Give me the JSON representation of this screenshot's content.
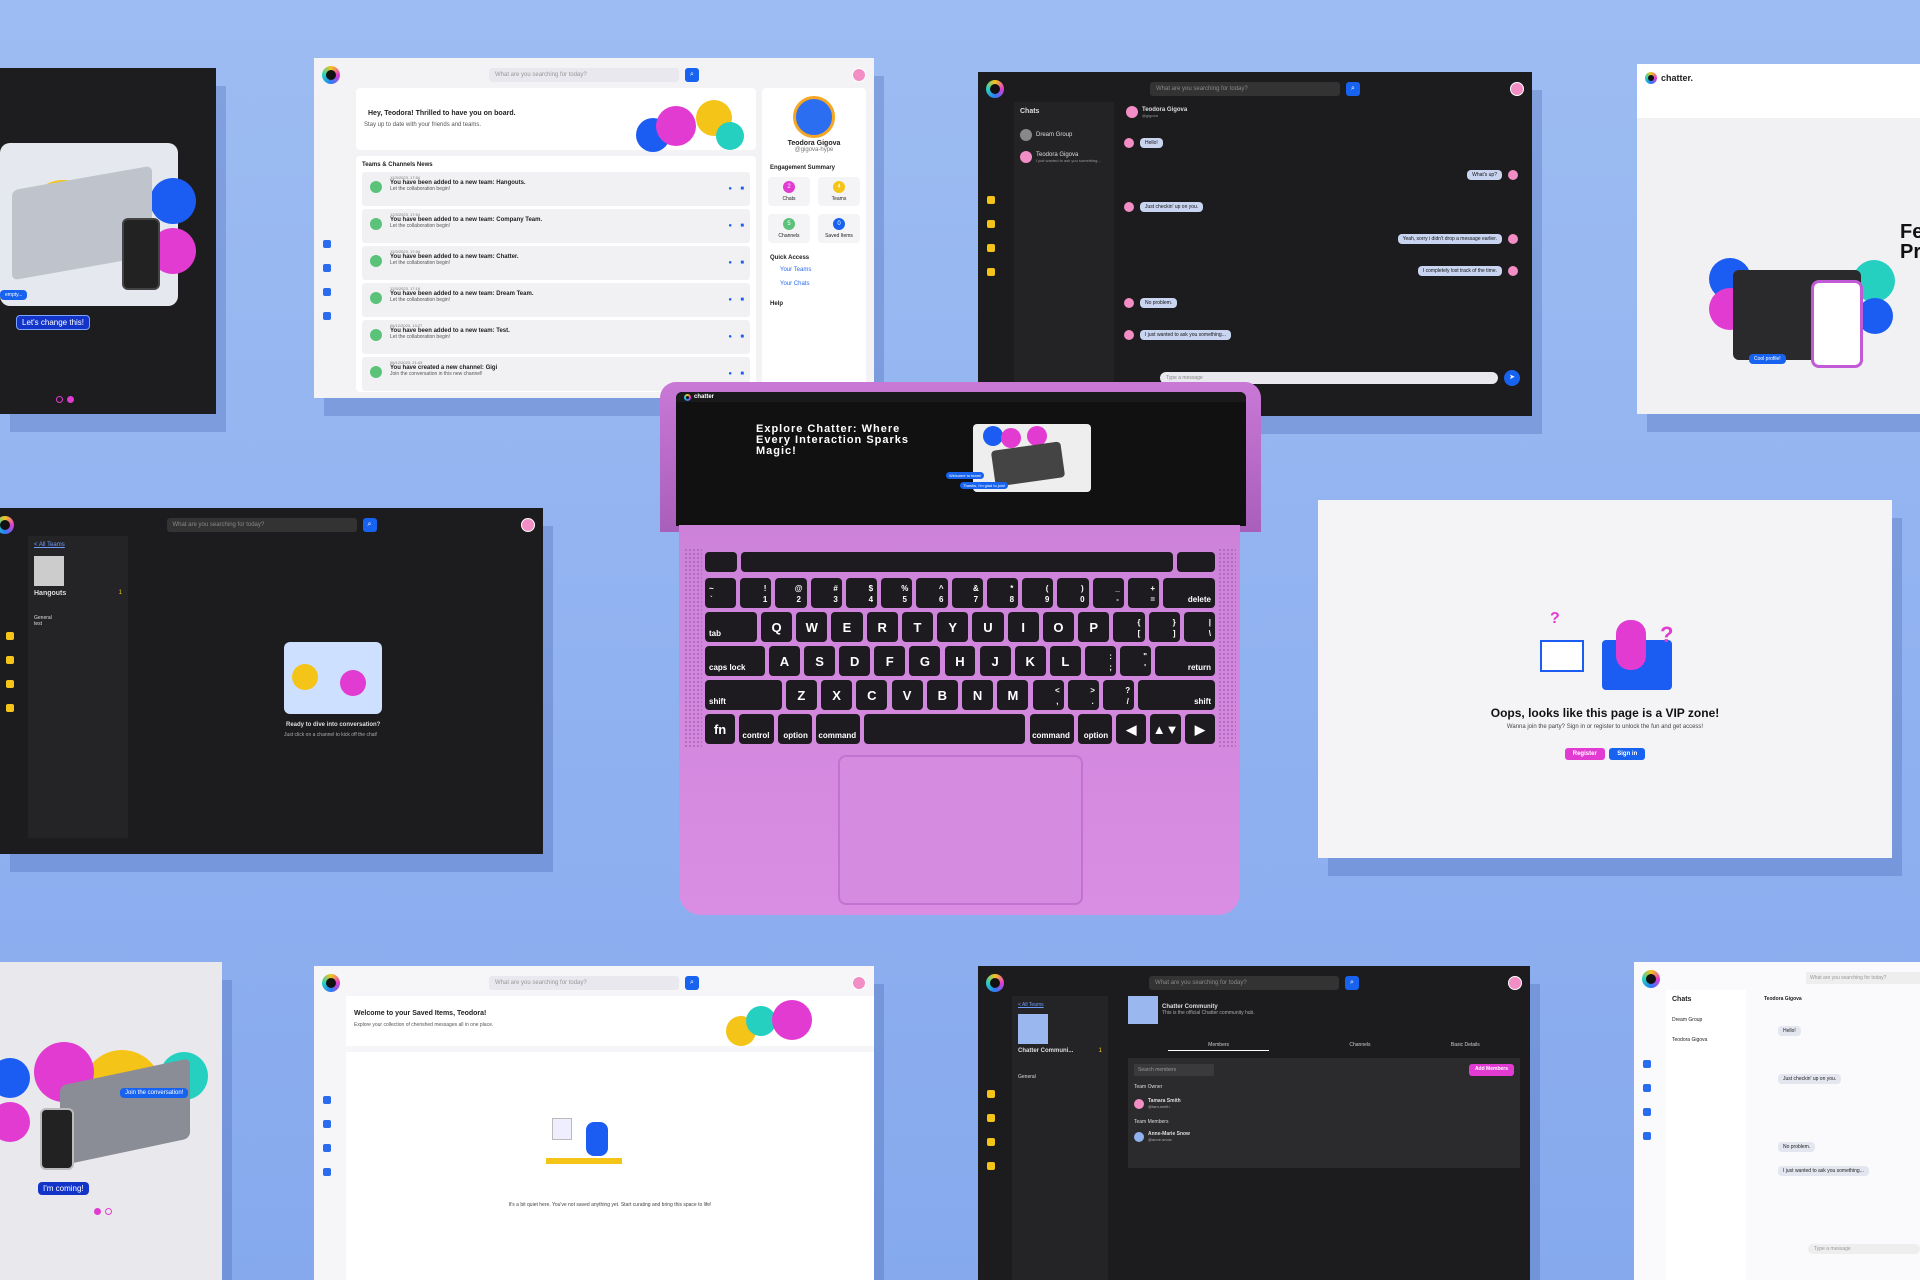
{
  "search_placeholder": "What are you searching for today?",
  "brand": "chatter.",
  "panel_tl": {
    "bubble1": "empty...",
    "cta": "Let's change this!"
  },
  "panel_insights": {
    "welcome_title": "Hey, Teodora! Thrilled to have you on board.",
    "welcome_sub": "Stay up to date with your friends and teams.",
    "news_header": "Teams & Channels News",
    "news": [
      {
        "date": "12/3/2023, 17:54",
        "title": "You have been added to a new team: Hangouts.",
        "sub": "Let the collaboration begin!"
      },
      {
        "date": "12/3/2023, 17:54",
        "title": "You have been added to a new team: Company Team.",
        "sub": "Let the collaboration begin!"
      },
      {
        "date": "12/3/2023, 17:54",
        "title": "You have been added to a new team: Chatter.",
        "sub": "Let the collaboration begin!"
      },
      {
        "date": "12/3/2023, 17:19",
        "title": "You have been added to a new team: Dream Team.",
        "sub": "Let the collaboration begin!"
      },
      {
        "date": "06/12/2023, 13:27",
        "title": "You have been added to a new team: Test.",
        "sub": "Let the collaboration begin!"
      },
      {
        "date": "06/12/2023, 21:43",
        "title": "You have created a new channel: Gigi",
        "sub": "Join the conversation in this new channel!"
      }
    ],
    "profile_name": "Teodora Gigova",
    "profile_handle": "@gigova-hype",
    "engagement": "Engagement Summary",
    "stats": [
      {
        "label": "Chats",
        "value": "2"
      },
      {
        "label": "Teams",
        "value": "4"
      },
      {
        "label": "Channels",
        "value": "5"
      },
      {
        "label": "Saved Items",
        "value": "0"
      }
    ],
    "quick_access": "Quick Access",
    "qa_links": [
      "Your Teams",
      "Your Chats"
    ],
    "help": "Help",
    "rail": [
      "Insights",
      "Chats",
      "Teams",
      "Later"
    ]
  },
  "panel_chat": {
    "chats_title": "Chats",
    "chat_items": [
      {
        "name": "Dream Group",
        "sub": ""
      },
      {
        "name": "Teodora Gigova",
        "sub": "I just wanted to ask you something..."
      }
    ],
    "header_name": "Teodora Gigova",
    "header_handle": "@gigova",
    "messages": [
      {
        "side": "left",
        "text": "Hello!"
      },
      {
        "side": "right",
        "text": "What's up?"
      },
      {
        "side": "left",
        "text": "Just checkin' up on you."
      },
      {
        "side": "right",
        "text": "Yeah, sorry i didn't drop a message earlier."
      },
      {
        "side": "right",
        "text": "I completely lost track of the time."
      },
      {
        "side": "left",
        "text": "No problem."
      },
      {
        "side": "left",
        "text": "I just wanted to ask you something..."
      }
    ],
    "input_placeholder": "Type a message"
  },
  "panel_feature": {
    "title_partial": "Fe Pro",
    "cta": "Cool profile!"
  },
  "panel_teams": {
    "back": "< All Teams",
    "team_name": "Hangouts",
    "team_count": "1",
    "channels": [
      "General",
      "test"
    ],
    "empty_title": "Ready to dive into conversation?",
    "empty_sub": "Just click on a channel to kick off the chat!"
  },
  "laptop": {
    "brand": "chatter",
    "hero_title": "Explore Chatter: Where Every Interaction Sparks Magic!",
    "bubble_a": "Welcome to team!",
    "bubble_b": "Thanks, I'm glad to join!"
  },
  "keyboard": {
    "row1": [
      "~\n`",
      "!\n1",
      "@\n2",
      "#\n3",
      "$\n4",
      "%\n5",
      "^\n6",
      "&\n7",
      "*\n8",
      "(\n9",
      ")\n0",
      "_\n-",
      "+\n=",
      "delete"
    ],
    "row2": [
      "tab",
      "Q",
      "W",
      "E",
      "R",
      "T",
      "Y",
      "U",
      "I",
      "O",
      "P",
      "{\n[",
      "}\n]",
      "|\n\\"
    ],
    "row3": [
      "caps lock",
      "A",
      "S",
      "D",
      "F",
      "G",
      "H",
      "J",
      "K",
      "L",
      ":\n;",
      "\"\n'",
      "return"
    ],
    "row4": [
      "shift",
      "Z",
      "X",
      "C",
      "V",
      "B",
      "N",
      "M",
      "<\n,",
      ">\n.",
      "?\n/",
      "shift"
    ],
    "row5": [
      "fn",
      "control",
      "option",
      "command",
      "",
      "command",
      "option",
      "◀",
      "▲▼",
      "▶"
    ]
  },
  "panel_vip": {
    "title": "Oops, looks like this page is a VIP zone!",
    "sub": "Wanna join the party? Sign in or register to unlock the fun and get access!",
    "register": "Register",
    "signin": "Sign in"
  },
  "panel_bl": {
    "bubble1": "Join the conversation!",
    "cta": "I'm coming!"
  },
  "panel_saved": {
    "title": "Welcome to your Saved Items, Teodora!",
    "sub": "Explore your collection of cherished messages all in one place.",
    "empty": "It's a bit quiet here. You've not saved anything yet. Start curating and bring this space to life!"
  },
  "panel_community": {
    "back": "< All Teams",
    "team_short": "Chatter Communi...",
    "team_count": "1",
    "channel": "General",
    "title": "Chatter Community",
    "desc": "This is the official Chatter community hub.",
    "tabs": [
      "Members",
      "Channels",
      "Basic Details"
    ],
    "search_placeholder": "Search members",
    "add_members": "Add Members",
    "owner_header": "Team Owner",
    "owner_name": "Tamara Smith",
    "owner_handle": "@tam-smith",
    "members_header": "Team Members",
    "member_name": "Anne-Marie Snow",
    "member_handle": "@anne-snow"
  },
  "panel_br": {
    "chats_title": "Chats",
    "items": [
      "Dream Group",
      "Teodora Gigova"
    ],
    "header": "Teodora Gigova",
    "messages": [
      "Hello!",
      "Just checkin' up on you.",
      "No problem.",
      "I just wanted to ask you something..."
    ],
    "input": "Type a message"
  }
}
